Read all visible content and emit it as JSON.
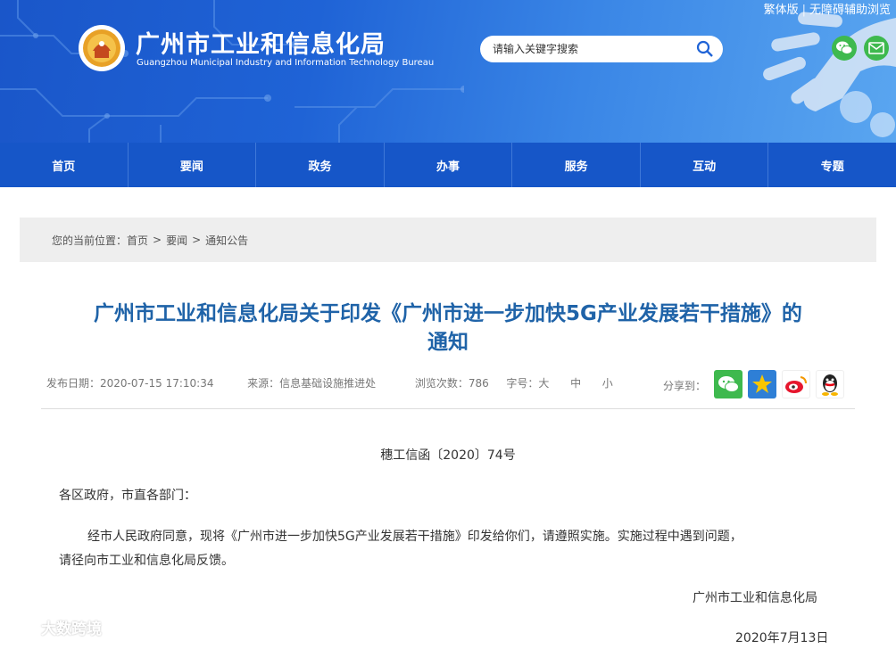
{
  "top_links": {
    "traditional": "繁体版",
    "separator": "|",
    "accessible": "无障碍辅助浏览"
  },
  "site": {
    "title": "广州市工业和信息化局",
    "subtitle": "Guangzhou Municipal Industry and Information Technology Bureau"
  },
  "search": {
    "placeholder": "请输入关键字搜索"
  },
  "nav": [
    "首页",
    "要闻",
    "政务",
    "办事",
    "服务",
    "互动",
    "专题"
  ],
  "breadcrumb": {
    "prefix": "您的当前位置：",
    "items": [
      "首页",
      "要闻",
      "通知公告"
    ],
    "sep": ">"
  },
  "article": {
    "title_line1": "广州市工业和信息化局关于印发《广州市进一步加快5G产业发展若干措施》的",
    "title_line2": "通知",
    "publish_label": "发布日期：",
    "publish_date": "2020-07-15 17:10:34",
    "source_label": "来源：",
    "source": "信息基础设施推进处",
    "views_label": "浏览次数：",
    "views": "786",
    "font_label": "字号：",
    "font_large": "大",
    "font_medium": "中",
    "font_small": "小",
    "share_label": "分享到：",
    "doc_no": "穗工信函〔2020〕74号",
    "salutation": "各区政府，市直各部门：",
    "body_line1": "经市人民政府同意，现将《广州市进一步加快5G产业发展若干措施》印发给你们，请遵照实施。实施过程中遇到问题，",
    "body_line2": "请径向市工业和信息化局反馈。",
    "signature": "广州市工业和信息化局",
    "date": "2020年7月13日"
  },
  "watermark": "大数跨境",
  "colors": {
    "header_blue": "#1f63d6",
    "nav_blue": "#1656c8",
    "title_blue": "#1f63a8",
    "wechat_green": "#3eb94e"
  }
}
